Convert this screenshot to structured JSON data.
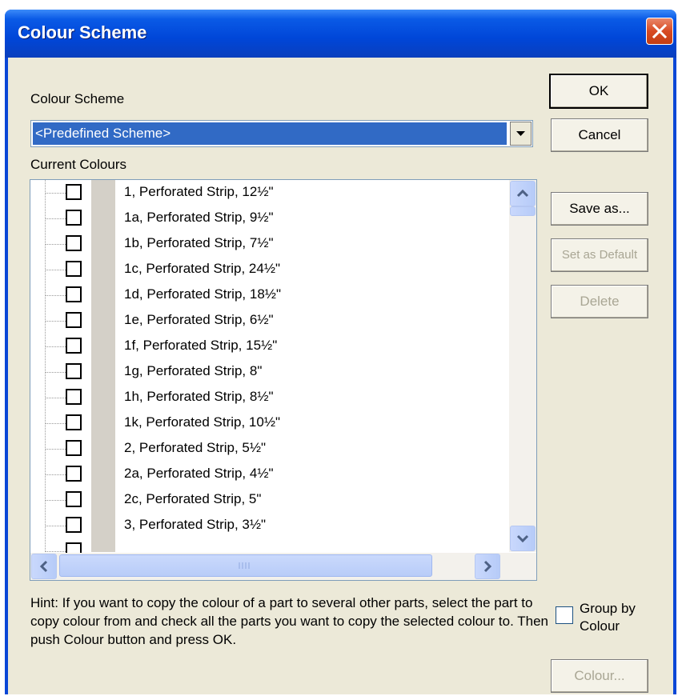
{
  "window": {
    "title": "Colour Scheme"
  },
  "scheme": {
    "label": "Colour Scheme",
    "selected": "<Predefined Scheme>"
  },
  "current_colours_label": "Current Colours",
  "parts": [
    "1, Perforated Strip, 12½\"",
    "1a, Perforated Strip, 9½\"",
    "1b, Perforated Strip, 7½\"",
    "1c, Perforated Strip, 24½\"",
    "1d, Perforated Strip, 18½\"",
    "1e, Perforated Strip, 6½\"",
    "1f, Perforated Strip, 15½\"",
    "1g, Perforated Strip, 8\"",
    "1h, Perforated Strip, 8½\"",
    "1k, Perforated Strip, 10½\"",
    "2, Perforated Strip, 5½\"",
    "2a, Perforated Strip, 4½\"",
    "2c, Perforated Strip, 5\"",
    "3, Perforated Strip, 3½\""
  ],
  "buttons": {
    "ok": "OK",
    "cancel": "Cancel",
    "save_as": "Save as...",
    "set_default": "Set as Default",
    "delete": "Delete",
    "colour": "Colour..."
  },
  "hint": "Hint: If you want to copy the colour of a part to several other parts, select the part to copy colour from and check all the parts you want to copy the selected colour to. Then push Colour button and press OK.",
  "group_by_colour": {
    "label": "Group by Colour",
    "checked": false
  },
  "colors": {
    "title_bar": "#0046d8",
    "selection": "#316ac5",
    "dialog_bg": "#ece9d8"
  }
}
